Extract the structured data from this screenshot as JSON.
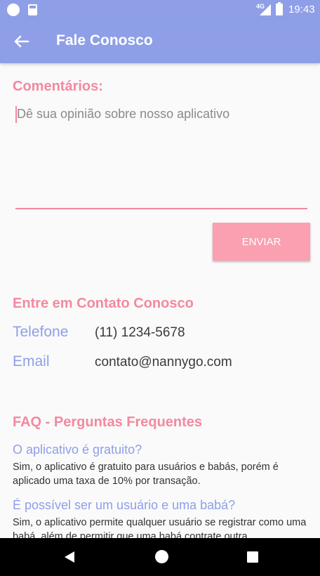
{
  "status_bar": {
    "time": "19:43",
    "network": "4G"
  },
  "app_bar": {
    "title": "Fale Conosco"
  },
  "comments": {
    "title": "Comentários:",
    "placeholder": "Dê sua opinião sobre nosso aplicativo",
    "value": "",
    "send_label": "ENVIAR"
  },
  "contact": {
    "title": "Entre em Contato Conosco",
    "phone_label": "Telefone",
    "phone_value": "(11) 1234-5678",
    "email_label": "Email",
    "email_value": "contato@nannygo.com"
  },
  "faq": {
    "title": "FAQ - Perguntas Frequentes",
    "items": [
      {
        "question": "O aplicativo é gratuito?",
        "answer": "Sim, o aplicativo é gratuito para usuários e babás, porém é aplicado uma taxa de 10% por transação."
      },
      {
        "question": "É possível ser um usuário e uma babá?",
        "answer": "Sim, o aplicativo permite qualquer usuário se registrar como uma babá, além de permitir que uma babá contrate outra."
      }
    ]
  },
  "colors": {
    "primary": "#8e9fe8",
    "accent": "#f3899f",
    "button": "#fba0b1"
  },
  "icons": {
    "back": "arrow-left-icon"
  }
}
